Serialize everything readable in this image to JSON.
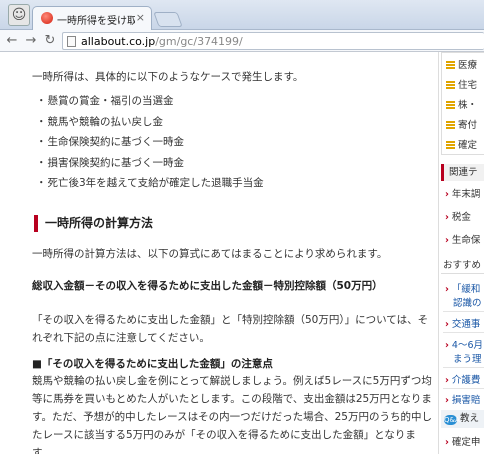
{
  "browser": {
    "tab_title": "一時所得を受け取った場",
    "tab_close": "×",
    "back": "←",
    "forward": "→",
    "reload": "↻",
    "url_domain": "allabout.co.jp",
    "url_path": "/gm/gc/374199/"
  },
  "article": {
    "intro": "一時所得は、具体的に以下のようなケースで発生します。",
    "cases": [
      "懸賞の賞金・福引の当選金",
      "競馬や競輪の払い戻し金",
      "生命保険契約に基づく一時金",
      "損害保険契約に基づく一時金",
      "死亡後3年を越えて支給が確定した退職手当金"
    ],
    "section_heading": "一時所得の計算方法",
    "calc_intro": "一時所得の計算方法は、以下の算式にあてはまることにより求められます。",
    "formula": "総収入金額－その収入を得るために支出した金額－特別控除額（50万円）",
    "note": "「その収入を得るために支出した金額」と「特別控除額（50万円）」については、それぞれ下記の点に注意してください。",
    "subheading": "■「その収入を得るために支出した金額」の注意点",
    "example": "競馬や競輪の払い戻し金を例にとって解説しましょう。例えば5レースに5万円ずつ均等に馬券を買いもとめた人がいたとします。この段階で、支出金額は25万円となります。ただ、予想が的中したレースはその内一つだけだった場合、25万円のうち的中したレースに該当する5万円のみが「その収入を得るために支出した金額」となります。"
  },
  "sidebar": {
    "top_items": [
      "医療",
      "住宅",
      "株・",
      "寄付",
      "確定"
    ],
    "kanren_heading": "関連テ",
    "kanren_items": [
      "年末調",
      "税金",
      "生命保"
    ],
    "recs_heading": "おすすめ",
    "recs_items": [
      {
        "label": "「緩和",
        "sub": "認識の"
      },
      {
        "label": "交通事"
      },
      {
        "label": "4～6月",
        "sub": "まう理"
      },
      {
        "label": "介護費"
      },
      {
        "label": "損害賠"
      }
    ],
    "qa_heading": "教え",
    "qa_icon": "Q&A",
    "qa_items": [
      "確定申"
    ]
  }
}
